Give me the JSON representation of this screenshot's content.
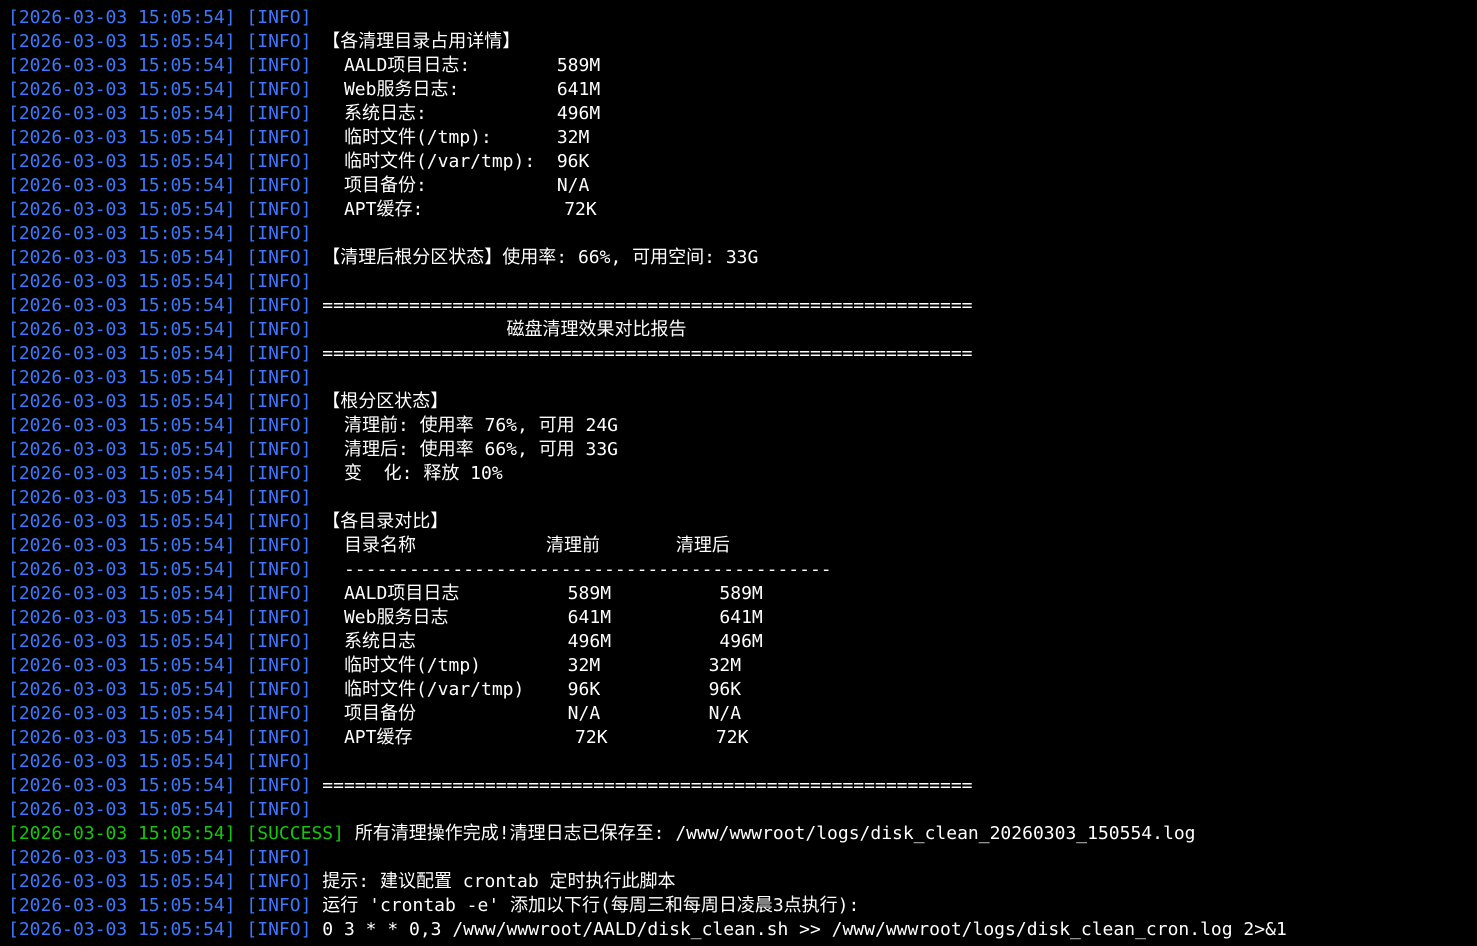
{
  "colors": {
    "background": "#000000",
    "timestamp": "#3b78ff",
    "info": "#3b78ff",
    "success": "#16c60c",
    "message": "#ffffff"
  },
  "lines": [
    {
      "ts": "[2026-03-03 15:05:54]",
      "level": "[INFO]",
      "msg": ""
    },
    {
      "ts": "[2026-03-03 15:05:54]",
      "level": "[INFO]",
      "msg": "【各清理目录占用详情】"
    },
    {
      "ts": "[2026-03-03 15:05:54]",
      "level": "[INFO]",
      "msg": "  AALD项目日志:        589M"
    },
    {
      "ts": "[2026-03-03 15:05:54]",
      "level": "[INFO]",
      "msg": "  Web服务日志:         641M"
    },
    {
      "ts": "[2026-03-03 15:05:54]",
      "level": "[INFO]",
      "msg": "  系统日志:            496M"
    },
    {
      "ts": "[2026-03-03 15:05:54]",
      "level": "[INFO]",
      "msg": "  临时文件(/tmp):      32M"
    },
    {
      "ts": "[2026-03-03 15:05:54]",
      "level": "[INFO]",
      "msg": "  临时文件(/var/tmp):  96K"
    },
    {
      "ts": "[2026-03-03 15:05:54]",
      "level": "[INFO]",
      "msg": "  项目备份:            N/A"
    },
    {
      "ts": "[2026-03-03 15:05:54]",
      "level": "[INFO]",
      "msg": "  APT缓存:             72K"
    },
    {
      "ts": "[2026-03-03 15:05:54]",
      "level": "[INFO]",
      "msg": ""
    },
    {
      "ts": "[2026-03-03 15:05:54]",
      "level": "[INFO]",
      "msg": "【清理后根分区状态】使用率: 66%, 可用空间: 33G"
    },
    {
      "ts": "[2026-03-03 15:05:54]",
      "level": "[INFO]",
      "msg": ""
    },
    {
      "ts": "[2026-03-03 15:05:54]",
      "level": "[INFO]",
      "msg": "============================================================"
    },
    {
      "ts": "[2026-03-03 15:05:54]",
      "level": "[INFO]",
      "msg": "                 磁盘清理效果对比报告"
    },
    {
      "ts": "[2026-03-03 15:05:54]",
      "level": "[INFO]",
      "msg": "============================================================"
    },
    {
      "ts": "[2026-03-03 15:05:54]",
      "level": "[INFO]",
      "msg": ""
    },
    {
      "ts": "[2026-03-03 15:05:54]",
      "level": "[INFO]",
      "msg": "【根分区状态】"
    },
    {
      "ts": "[2026-03-03 15:05:54]",
      "level": "[INFO]",
      "msg": "  清理前: 使用率 76%, 可用 24G"
    },
    {
      "ts": "[2026-03-03 15:05:54]",
      "level": "[INFO]",
      "msg": "  清理后: 使用率 66%, 可用 33G"
    },
    {
      "ts": "[2026-03-03 15:05:54]",
      "level": "[INFO]",
      "msg": "  变  化: 释放 10%"
    },
    {
      "ts": "[2026-03-03 15:05:54]",
      "level": "[INFO]",
      "msg": ""
    },
    {
      "ts": "[2026-03-03 15:05:54]",
      "level": "[INFO]",
      "msg": "【各目录对比】"
    },
    {
      "ts": "[2026-03-03 15:05:54]",
      "level": "[INFO]",
      "msg": "  目录名称            清理前       清理后"
    },
    {
      "ts": "[2026-03-03 15:05:54]",
      "level": "[INFO]",
      "msg": "  ---------------------------------------------"
    },
    {
      "ts": "[2026-03-03 15:05:54]",
      "level": "[INFO]",
      "msg": "  AALD项目日志          589M          589M"
    },
    {
      "ts": "[2026-03-03 15:05:54]",
      "level": "[INFO]",
      "msg": "  Web服务日志           641M          641M"
    },
    {
      "ts": "[2026-03-03 15:05:54]",
      "level": "[INFO]",
      "msg": "  系统日志              496M          496M"
    },
    {
      "ts": "[2026-03-03 15:05:54]",
      "level": "[INFO]",
      "msg": "  临时文件(/tmp)        32M          32M"
    },
    {
      "ts": "[2026-03-03 15:05:54]",
      "level": "[INFO]",
      "msg": "  临时文件(/var/tmp)    96K          96K"
    },
    {
      "ts": "[2026-03-03 15:05:54]",
      "level": "[INFO]",
      "msg": "  项目备份              N/A          N/A"
    },
    {
      "ts": "[2026-03-03 15:05:54]",
      "level": "[INFO]",
      "msg": "  APT缓存               72K          72K"
    },
    {
      "ts": "[2026-03-03 15:05:54]",
      "level": "[INFO]",
      "msg": ""
    },
    {
      "ts": "[2026-03-03 15:05:54]",
      "level": "[INFO]",
      "msg": "============================================================"
    },
    {
      "ts": "[2026-03-03 15:05:54]",
      "level": "[INFO]",
      "msg": ""
    },
    {
      "ts": "[2026-03-03 15:05:54]",
      "level": "[SUCCESS]",
      "msg": "所有清理操作完成!清理日志已保存至: /www/wwwroot/logs/disk_clean_20260303_150554.log",
      "type": "success"
    },
    {
      "ts": "[2026-03-03 15:05:54]",
      "level": "[INFO]",
      "msg": ""
    },
    {
      "ts": "[2026-03-03 15:05:54]",
      "level": "[INFO]",
      "msg": "提示: 建议配置 crontab 定时执行此脚本"
    },
    {
      "ts": "[2026-03-03 15:05:54]",
      "level": "[INFO]",
      "msg": "运行 'crontab -e' 添加以下行(每周三和每周日凌晨3点执行):"
    },
    {
      "ts": "[2026-03-03 15:05:54]",
      "level": "[INFO]",
      "msg": "0 3 * * 0,3 /www/wwwroot/AALD/disk_clean.sh >> /www/wwwroot/logs/disk_clean_cron.log 2>&1"
    }
  ]
}
